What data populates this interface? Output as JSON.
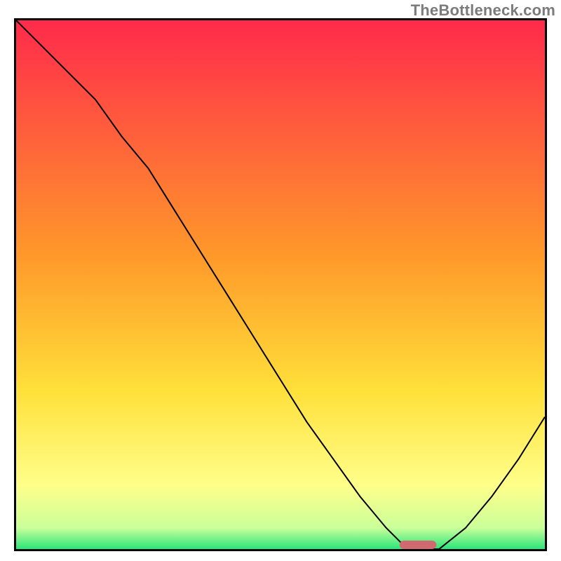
{
  "attribution": "TheBottleneck.com",
  "chart_data": {
    "type": "line",
    "title": "",
    "xlabel": "",
    "ylabel": "",
    "xlim": [
      0,
      100
    ],
    "ylim": [
      0,
      100
    ],
    "series": [
      {
        "name": "curve",
        "x": [
          0,
          5,
          10,
          15,
          20,
          25,
          30,
          35,
          40,
          45,
          50,
          55,
          60,
          65,
          70,
          73,
          76,
          80,
          85,
          90,
          95,
          100
        ],
        "y": [
          100,
          95,
          90,
          85,
          78,
          72,
          64,
          56,
          48,
          40,
          32,
          24,
          17,
          10,
          4,
          1,
          0,
          0,
          4,
          10,
          17,
          25
        ]
      }
    ],
    "marker": {
      "x": 76,
      "y": 0,
      "color": "#d06a6f",
      "width": 7,
      "height": 1.6
    },
    "gradient_stops": [
      {
        "offset": 0,
        "color": "#ff2a4b"
      },
      {
        "offset": 0.45,
        "color": "#ff9a2a"
      },
      {
        "offset": 0.7,
        "color": "#ffe03a"
      },
      {
        "offset": 0.88,
        "color": "#ffff8a"
      },
      {
        "offset": 0.96,
        "color": "#caff9a"
      },
      {
        "offset": 1,
        "color": "#29e57a"
      }
    ]
  }
}
